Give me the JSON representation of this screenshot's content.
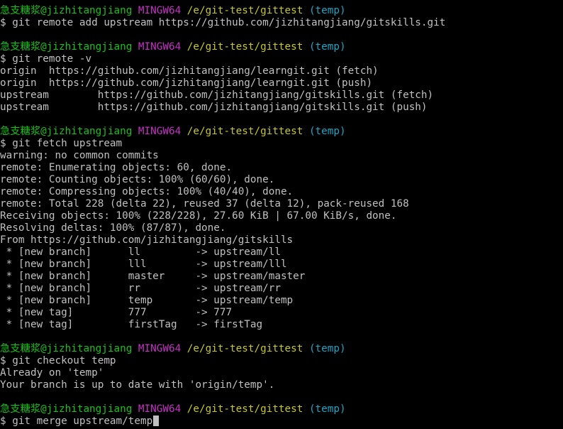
{
  "prompt": {
    "user": "急支糖浆@jizhitangjiang",
    "shell": "MINGW64",
    "path": "/e/git-test/gittest",
    "branch": "(temp)"
  },
  "lines": [
    {
      "type": "prompt"
    },
    {
      "type": "text",
      "text": "$ git remote add upstream https://github.com/jizhitangjiang/gitskills.git"
    },
    {
      "type": "blank"
    },
    {
      "type": "prompt"
    },
    {
      "type": "text",
      "text": "$ git remote -v"
    },
    {
      "type": "text",
      "text": "origin  https://github.com/jizhitangjiang/learngit.git (fetch)"
    },
    {
      "type": "text",
      "text": "origin  https://github.com/jizhitangjiang/learngit.git (push)"
    },
    {
      "type": "text",
      "text": "upstream        https://github.com/jizhitangjiang/gitskills.git (fetch)"
    },
    {
      "type": "text",
      "text": "upstream        https://github.com/jizhitangjiang/gitskills.git (push)"
    },
    {
      "type": "blank"
    },
    {
      "type": "prompt"
    },
    {
      "type": "text",
      "text": "$ git fetch upstream"
    },
    {
      "type": "text",
      "text": "warning: no common commits"
    },
    {
      "type": "text",
      "text": "remote: Enumerating objects: 60, done."
    },
    {
      "type": "text",
      "text": "remote: Counting objects: 100% (60/60), done."
    },
    {
      "type": "text",
      "text": "remote: Compressing objects: 100% (40/40), done."
    },
    {
      "type": "text",
      "text": "remote: Total 228 (delta 22), reused 37 (delta 12), pack-reused 168"
    },
    {
      "type": "text",
      "text": "Receiving objects: 100% (228/228), 27.60 KiB | 67.00 KiB/s, done."
    },
    {
      "type": "text",
      "text": "Resolving deltas: 100% (87/87), done."
    },
    {
      "type": "text",
      "text": "From https://github.com/jizhitangjiang/gitskills"
    },
    {
      "type": "text",
      "text": " * [new branch]      ll         -> upstream/ll"
    },
    {
      "type": "text",
      "text": " * [new branch]      lll        -> upstream/lll"
    },
    {
      "type": "text",
      "text": " * [new branch]      master     -> upstream/master"
    },
    {
      "type": "text",
      "text": " * [new branch]      rr         -> upstream/rr"
    },
    {
      "type": "text",
      "text": " * [new branch]      temp       -> upstream/temp"
    },
    {
      "type": "text",
      "text": " * [new tag]         777        -> 777"
    },
    {
      "type": "text",
      "text": " * [new tag]         firstTag   -> firstTag"
    },
    {
      "type": "blank"
    },
    {
      "type": "prompt"
    },
    {
      "type": "text",
      "text": "$ git checkout temp"
    },
    {
      "type": "text",
      "text": "Already on 'temp'"
    },
    {
      "type": "text",
      "text": "Your branch is up to date with 'origin/temp'."
    },
    {
      "type": "blank"
    },
    {
      "type": "prompt"
    },
    {
      "type": "text",
      "text": "$ git merge upstream/temp",
      "cursor": true
    }
  ]
}
